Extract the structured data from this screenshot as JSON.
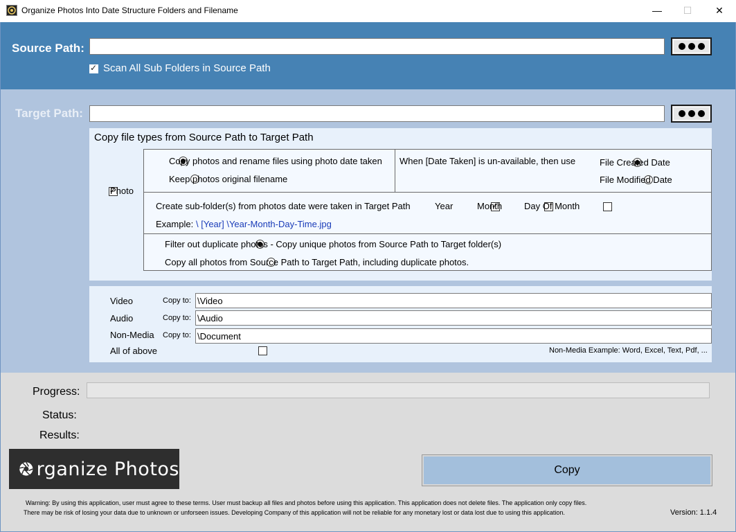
{
  "window": {
    "title": "Organize Photos Into Date Structure Folders and Filename",
    "minimize_glyph": "—",
    "maximize_glyph": "☐",
    "close_glyph": "✕"
  },
  "source": {
    "label": "Source Path:",
    "value": "",
    "scan_subfolders_label": "Scan All Sub Folders in Source Path",
    "scan_subfolders_checked": true
  },
  "target": {
    "label": "Target Path:",
    "value": ""
  },
  "copy_types": {
    "heading": "Copy file types from Source Path to Target Path",
    "photo": {
      "label": "Photo",
      "checked": true,
      "rename_option": "Copy photos and rename files using photo date taken",
      "keep_option": "Keep photos original filename",
      "fallback_label": "When [Date Taken] is un-available, then use",
      "created_option": "File Created Date",
      "modified_option": "File Modified Date",
      "subfolder_label": "Create sub-folder(s) from photos date were taken in Target Path",
      "year_label": "Year",
      "month_label": "Month",
      "day_label": "Day Of Month",
      "example_label": "Example:",
      "example_value": "\\ [Year] \\Year-Month-Day-Time.jpg",
      "filter_option": "Filter out duplicate photos - Copy unique photos from Source Path to Target folder(s)",
      "copy_all_option": "Copy all photos from Source Path to Target Path, including duplicate photos."
    },
    "others": {
      "video_label": "Video",
      "audio_label": "Audio",
      "nonmedia_label": "Non-Media",
      "all_label": "All of above",
      "copy_to_label": "Copy to:",
      "video_path": "\\Video",
      "audio_path": "\\Audio",
      "document_path": "\\Document",
      "nonmedia_example": "Non-Media Example: Word, Excel, Text, Pdf, ..."
    }
  },
  "status_area": {
    "progress_label": "Progress:",
    "progress_value": 0,
    "status_label": "Status:",
    "results_label": "Results:",
    "copy_button": "Copy",
    "logo_text": "rganize Photos",
    "warning_line1": "Warning:  By using this application, user must agree to these terms.  User must backup all files and photos before using this application.  This application does not delete files.  The application only copy files.",
    "warning_line2": "There may be risk of losing your data due to unknown or unforseen issues.  Developing Company of this application will not be reliable for any monetary lost or data lost due to using this application.",
    "version": "Version: 1.1.4"
  },
  "colors": {
    "source_band": "#4682b4",
    "target_band": "#b0c4de",
    "bottom_band": "#dcdcdc",
    "copy_button": "#a3bfdc"
  }
}
